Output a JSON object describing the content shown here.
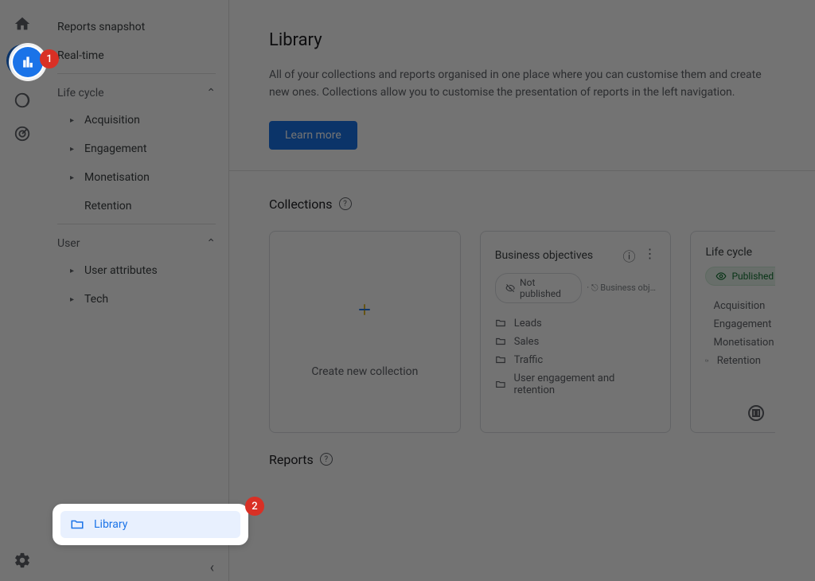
{
  "nav": {
    "items_top": [
      {
        "label": "Reports snapshot"
      },
      {
        "label": "Real-time"
      }
    ],
    "section_lifecycle": "Life cycle",
    "lifecycle_items": [
      {
        "label": "Acquisition"
      },
      {
        "label": "Engagement"
      },
      {
        "label": "Monetisation"
      },
      {
        "label": "Retention"
      }
    ],
    "section_user": "User",
    "user_items": [
      {
        "label": "User attributes"
      },
      {
        "label": "Tech"
      }
    ]
  },
  "library": {
    "title": "Library",
    "description": "All of your collections and reports organised in one place where you can customise them and create new ones. Collections allow you to customise the presentation of reports in the left navigation.",
    "learn_more": "Learn more",
    "collections_heading": "Collections",
    "reports_heading": "Reports",
    "create_new_label": "Create new collection"
  },
  "cards": {
    "business": {
      "title": "Business objectives",
      "status": "Not published",
      "extra": "Business objec…",
      "items": [
        "Leads",
        "Sales",
        "Traffic",
        "User engagement and retention"
      ]
    },
    "lifecycle": {
      "title": "Life cycle",
      "status": "Published",
      "items": [
        "Acquisition",
        "Engagement",
        "Monetisation",
        "Retention"
      ]
    }
  },
  "callouts": {
    "badge1": "1",
    "badge2": "2",
    "library_label": "Library"
  }
}
